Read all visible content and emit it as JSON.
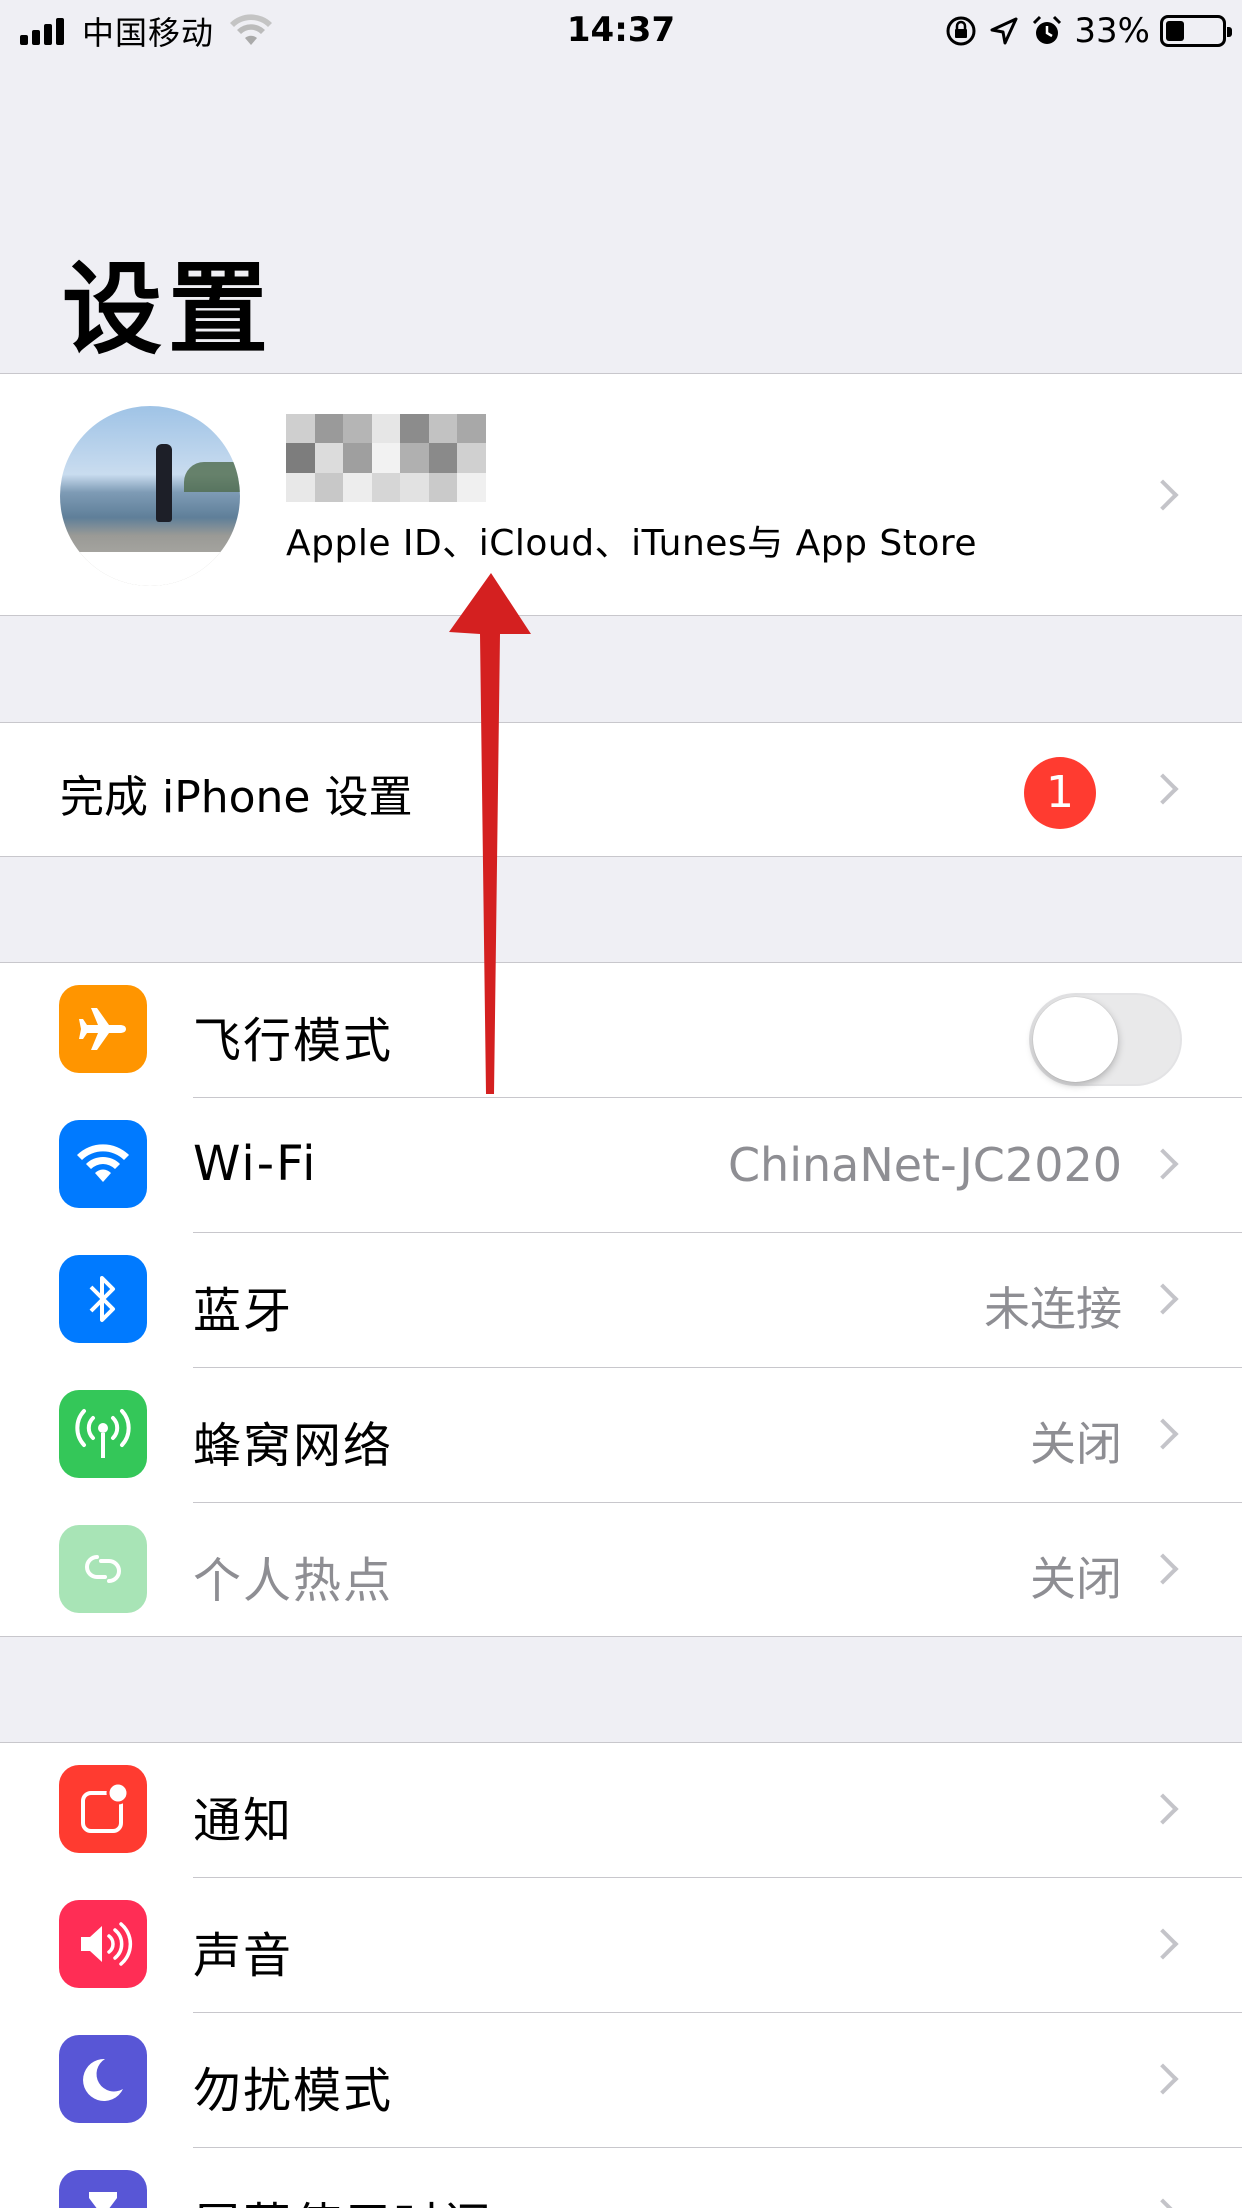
{
  "status_bar": {
    "carrier": "中国移动",
    "time": "14:37",
    "battery_percent_text": "33%",
    "battery_level": 0.33
  },
  "page": {
    "title": "设置"
  },
  "profile": {
    "subtitle": "Apple ID、iCloud、iTunes与 App Store",
    "name_obscured": true
  },
  "finish_setup": {
    "label": "完成 iPhone 设置",
    "badge_count": "1"
  },
  "connectivity": [
    {
      "label": "飞行模式",
      "icon": "airplane-icon",
      "color": "#ff9500",
      "type": "toggle",
      "on": false
    },
    {
      "label": "Wi-Fi",
      "icon": "wifi-icon",
      "color": "#007aff",
      "value": "ChinaNet-JC2020"
    },
    {
      "label": "蓝牙",
      "icon": "bluetooth-icon",
      "color": "#007aff",
      "value": "未连接"
    },
    {
      "label": "蜂窝网络",
      "icon": "cellular-icon",
      "color": "#34c759",
      "value": "关闭"
    },
    {
      "label": "个人热点",
      "icon": "hotspot-icon",
      "color": "#a8e4b6",
      "value": "关闭",
      "disabled": true
    }
  ],
  "general": [
    {
      "label": "通知",
      "icon": "notifications-icon",
      "color": "#ff3b30"
    },
    {
      "label": "声音",
      "icon": "sounds-icon",
      "color": "#ff2d55"
    },
    {
      "label": "勿扰模式",
      "icon": "moon-icon",
      "color": "#5856d6"
    },
    {
      "label": "屏幕使用时间",
      "icon": "hourglass-icon",
      "color": "#5856d6"
    }
  ],
  "colors": {
    "background": "#efeff4",
    "separator": "#c8c7cc",
    "secondary_text": "#8e8e93",
    "badge": "#ff3b30",
    "annotation_arrow": "#d42020"
  }
}
